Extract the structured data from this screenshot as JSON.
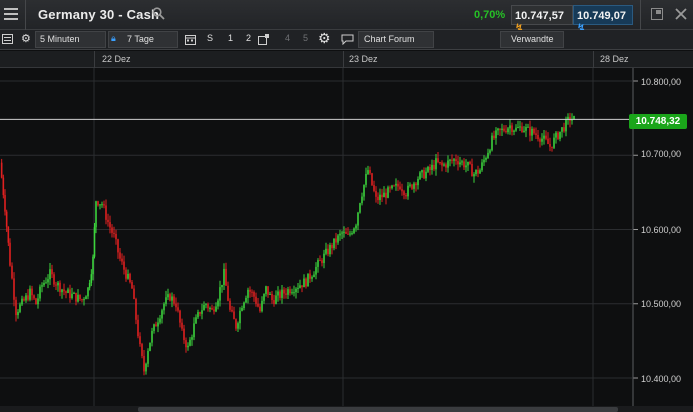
{
  "header": {
    "title": "Germany 30 - Cash",
    "change_pct": "0,70%",
    "bid": "10.747,57",
    "ask": "10.749,07",
    "colors": {
      "up": "#26c026",
      "bid_arrow": "#f0a020",
      "ask_arrow": "#3aa0ff"
    }
  },
  "toolbar": {
    "interval": "5 Minuten",
    "range": "7 Tage",
    "buttons": [
      "S",
      "1",
      "2",
      "4",
      "5"
    ],
    "chart_forum": "Chart Forum",
    "related": "Verwandte"
  },
  "dates": [
    "22 Dez",
    "23 Dez",
    "28 Dez"
  ],
  "chart_data": {
    "type": "candlestick",
    "yaxis_labels": [
      "10.800,00",
      "10.700,00",
      "10.600,00",
      "10.500,00",
      "10.400,00"
    ],
    "ylim": [
      10390,
      10810
    ],
    "current_price": "10.748,32",
    "current_price_value": 10748.32,
    "colors": {
      "up": "#3cd43c",
      "down": "#e02020"
    },
    "x_labels": [
      "22 Dez",
      "23 Dez",
      "28 Dez"
    ],
    "grid": true,
    "price_path": [
      [
        0,
        10690
      ],
      [
        5,
        10630
      ],
      [
        10,
        10555
      ],
      [
        16,
        10490
      ],
      [
        22,
        10500
      ],
      [
        30,
        10515
      ],
      [
        36,
        10500
      ],
      [
        42,
        10525
      ],
      [
        50,
        10540
      ],
      [
        58,
        10525
      ],
      [
        66,
        10515
      ],
      [
        74,
        10510
      ],
      [
        82,
        10505
      ],
      [
        88,
        10520
      ],
      [
        93,
        10560
      ],
      [
        96,
        10640
      ],
      [
        102,
        10635
      ],
      [
        108,
        10610
      ],
      [
        114,
        10590
      ],
      [
        120,
        10560
      ],
      [
        126,
        10540
      ],
      [
        132,
        10520
      ],
      [
        136,
        10480
      ],
      [
        140,
        10440
      ],
      [
        144,
        10410
      ],
      [
        148,
        10440
      ],
      [
        152,
        10460
      ],
      [
        158,
        10480
      ],
      [
        164,
        10500
      ],
      [
        170,
        10510
      ],
      [
        176,
        10500
      ],
      [
        182,
        10460
      ],
      [
        188,
        10440
      ],
      [
        194,
        10470
      ],
      [
        200,
        10490
      ],
      [
        206,
        10500
      ],
      [
        212,
        10490
      ],
      [
        218,
        10510
      ],
      [
        224,
        10540
      ],
      [
        230,
        10490
      ],
      [
        236,
        10470
      ],
      [
        242,
        10500
      ],
      [
        248,
        10520
      ],
      [
        254,
        10510
      ],
      [
        260,
        10490
      ],
      [
        266,
        10520
      ],
      [
        272,
        10505
      ],
      [
        278,
        10510
      ],
      [
        284,
        10515
      ],
      [
        290,
        10520
      ],
      [
        298,
        10525
      ],
      [
        306,
        10530
      ],
      [
        314,
        10545
      ],
      [
        322,
        10560
      ],
      [
        330,
        10575
      ],
      [
        336,
        10585
      ],
      [
        342,
        10595
      ],
      [
        348,
        10590
      ],
      [
        352,
        10600
      ],
      [
        356,
        10610
      ],
      [
        360,
        10640
      ],
      [
        364,
        10660
      ],
      [
        368,
        10680
      ],
      [
        372,
        10660
      ],
      [
        376,
        10640
      ],
      [
        382,
        10645
      ],
      [
        388,
        10650
      ],
      [
        394,
        10655
      ],
      [
        400,
        10660
      ],
      [
        406,
        10650
      ],
      [
        412,
        10660
      ],
      [
        418,
        10670
      ],
      [
        424,
        10675
      ],
      [
        430,
        10680
      ],
      [
        436,
        10690
      ],
      [
        442,
        10685
      ],
      [
        448,
        10690
      ],
      [
        456,
        10695
      ],
      [
        462,
        10690
      ],
      [
        468,
        10685
      ],
      [
        474,
        10675
      ],
      [
        480,
        10680
      ],
      [
        486,
        10700
      ],
      [
        492,
        10720
      ],
      [
        498,
        10730
      ],
      [
        504,
        10735
      ],
      [
        510,
        10740
      ],
      [
        516,
        10735
      ],
      [
        522,
        10738
      ],
      [
        528,
        10733
      ],
      [
        534,
        10730
      ],
      [
        540,
        10725
      ],
      [
        546,
        10718
      ],
      [
        550,
        10712
      ],
      [
        554,
        10720
      ],
      [
        558,
        10728
      ],
      [
        562,
        10735
      ],
      [
        566,
        10742
      ],
      [
        570,
        10750
      ],
      [
        574,
        10748
      ]
    ]
  }
}
